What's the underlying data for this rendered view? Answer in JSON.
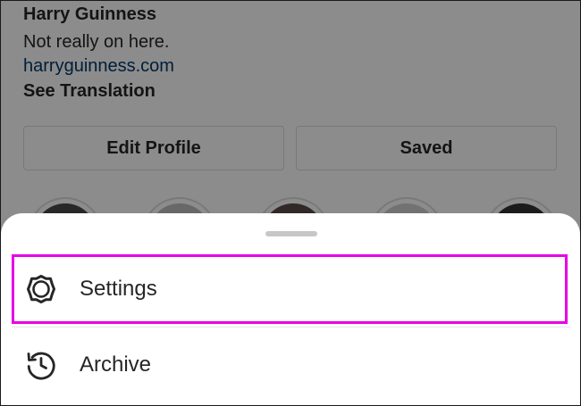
{
  "profile": {
    "name": "Harry Guinness",
    "bio": "Not really on here.",
    "website": "harryguinness.com",
    "see_translation": "See Translation",
    "edit_profile_label": "Edit Profile",
    "saved_label": "Saved"
  },
  "sheet": {
    "items": [
      {
        "label": "Settings",
        "icon": "gear-icon",
        "highlighted": true
      },
      {
        "label": "Archive",
        "icon": "history-clock-icon",
        "highlighted": false
      }
    ]
  },
  "colors": {
    "highlight_border": "#e600e6",
    "link": "#00376b",
    "text": "#262626"
  }
}
